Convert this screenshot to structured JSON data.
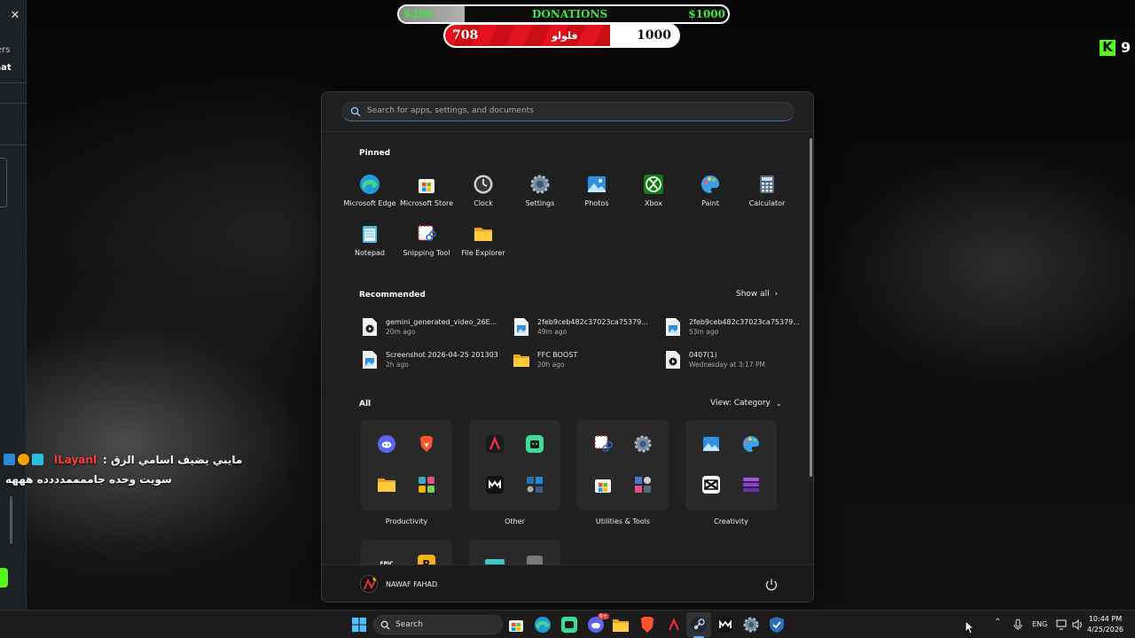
{
  "side_panel": {
    "close_icon": "close-icon",
    "text_viewers": "ers",
    "text_chat": "hat"
  },
  "chat": {
    "message_1": "مايبي يضيف اسامي الزق :",
    "username": "lLayanl",
    "message_2": "سويت وحده جاممممدددده هههه"
  },
  "overlay": {
    "donations": {
      "left_label": "$200",
      "center_label": "DONATIONS",
      "right_label": "$1000",
      "progress_fraction": 0.2
    },
    "followers": {
      "current": "708",
      "label": "فلولو",
      "goal": "1000",
      "progress_fraction": 0.708
    },
    "kick_count": "9",
    "colors": {
      "kick_green": "#53fc18",
      "follower_red": "#e3121c",
      "donation_green": "#3ee63e"
    }
  },
  "start_menu": {
    "search_placeholder": "Search for apps, settings, and documents",
    "pinned_title": "Pinned",
    "pinned": [
      {
        "label": "Microsoft Edge",
        "icon": "edge-icon"
      },
      {
        "label": "Microsoft Store",
        "icon": "store-icon"
      },
      {
        "label": "Clock",
        "icon": "clock-icon"
      },
      {
        "label": "Settings",
        "icon": "settings-gear-icon"
      },
      {
        "label": "Photos",
        "icon": "photos-icon"
      },
      {
        "label": "Xbox",
        "icon": "xbox-icon"
      },
      {
        "label": "Paint",
        "icon": "paint-palette-icon"
      },
      {
        "label": "Calculator",
        "icon": "calculator-icon"
      },
      {
        "label": "Notepad",
        "icon": "notepad-icon"
      },
      {
        "label": "Snipping Tool",
        "icon": "snipping-tool-icon"
      },
      {
        "label": "File Explorer",
        "icon": "folder-icon"
      }
    ],
    "recommended_title": "Recommended",
    "show_all": "Show all",
    "recommended": [
      {
        "name": "gemini_generated_video_26E...",
        "time": "20m ago",
        "icon": "video-file-icon"
      },
      {
        "name": "2feb9ceb482c37023ca75379...",
        "time": "49m ago",
        "icon": "image-file-icon"
      },
      {
        "name": "2feb9ceb482c37023ca75379...",
        "time": "53m ago",
        "icon": "image-file-icon"
      },
      {
        "name": "Screenshot 2026-04-25 201303",
        "time": "2h ago",
        "icon": "image-file-icon"
      },
      {
        "name": "FFC BOOST",
        "time": "20h ago",
        "icon": "folder-icon"
      },
      {
        "name": "0407(1)",
        "time": "Wednesday at 3:17 PM",
        "icon": "video-file-icon"
      }
    ],
    "all_title": "All",
    "view_label": "View: Category",
    "categories": [
      {
        "label": "Productivity",
        "icons": [
          "discord-icon",
          "brave-icon",
          "folder-icon",
          "grid-app-icon"
        ]
      },
      {
        "label": "Other",
        "icons": [
          "affinity-icon",
          "android-app-icon",
          "capcut-m-icon",
          "multi-app-icon"
        ]
      },
      {
        "label": "Utilities & Tools",
        "icons": [
          "snipping-tool-icon",
          "settings-gear-icon",
          "store-icon",
          "multi-app-icon"
        ]
      },
      {
        "label": "Creativity",
        "icons": [
          "photos-icon",
          "paint-palette-icon",
          "capcut-icon",
          "layers-icon"
        ]
      }
    ],
    "partial_categories": [
      {
        "icons": [
          "epic-games-icon",
          "rockstar-icon"
        ]
      },
      {
        "icons": [
          "teal-app-icon",
          "gray-app-icon"
        ]
      }
    ],
    "user_name": "NAWAF FAHAD",
    "power_icon": "power-icon"
  },
  "taskbar": {
    "search_label": "Search",
    "apps": [
      "windows-start-icon",
      "search-icon",
      "store-icon",
      "edge-icon",
      "android-app-icon",
      "discord-icon",
      "folder-icon",
      "brave-icon",
      "affinity-icon",
      "steam-icon",
      "capcut-m-icon",
      "settings-gear-icon",
      "vpn-shield-icon"
    ],
    "discord_badge": "9+",
    "tray": {
      "language": "ENG",
      "time": "10:44 PM",
      "date": "4/25/2026"
    }
  }
}
